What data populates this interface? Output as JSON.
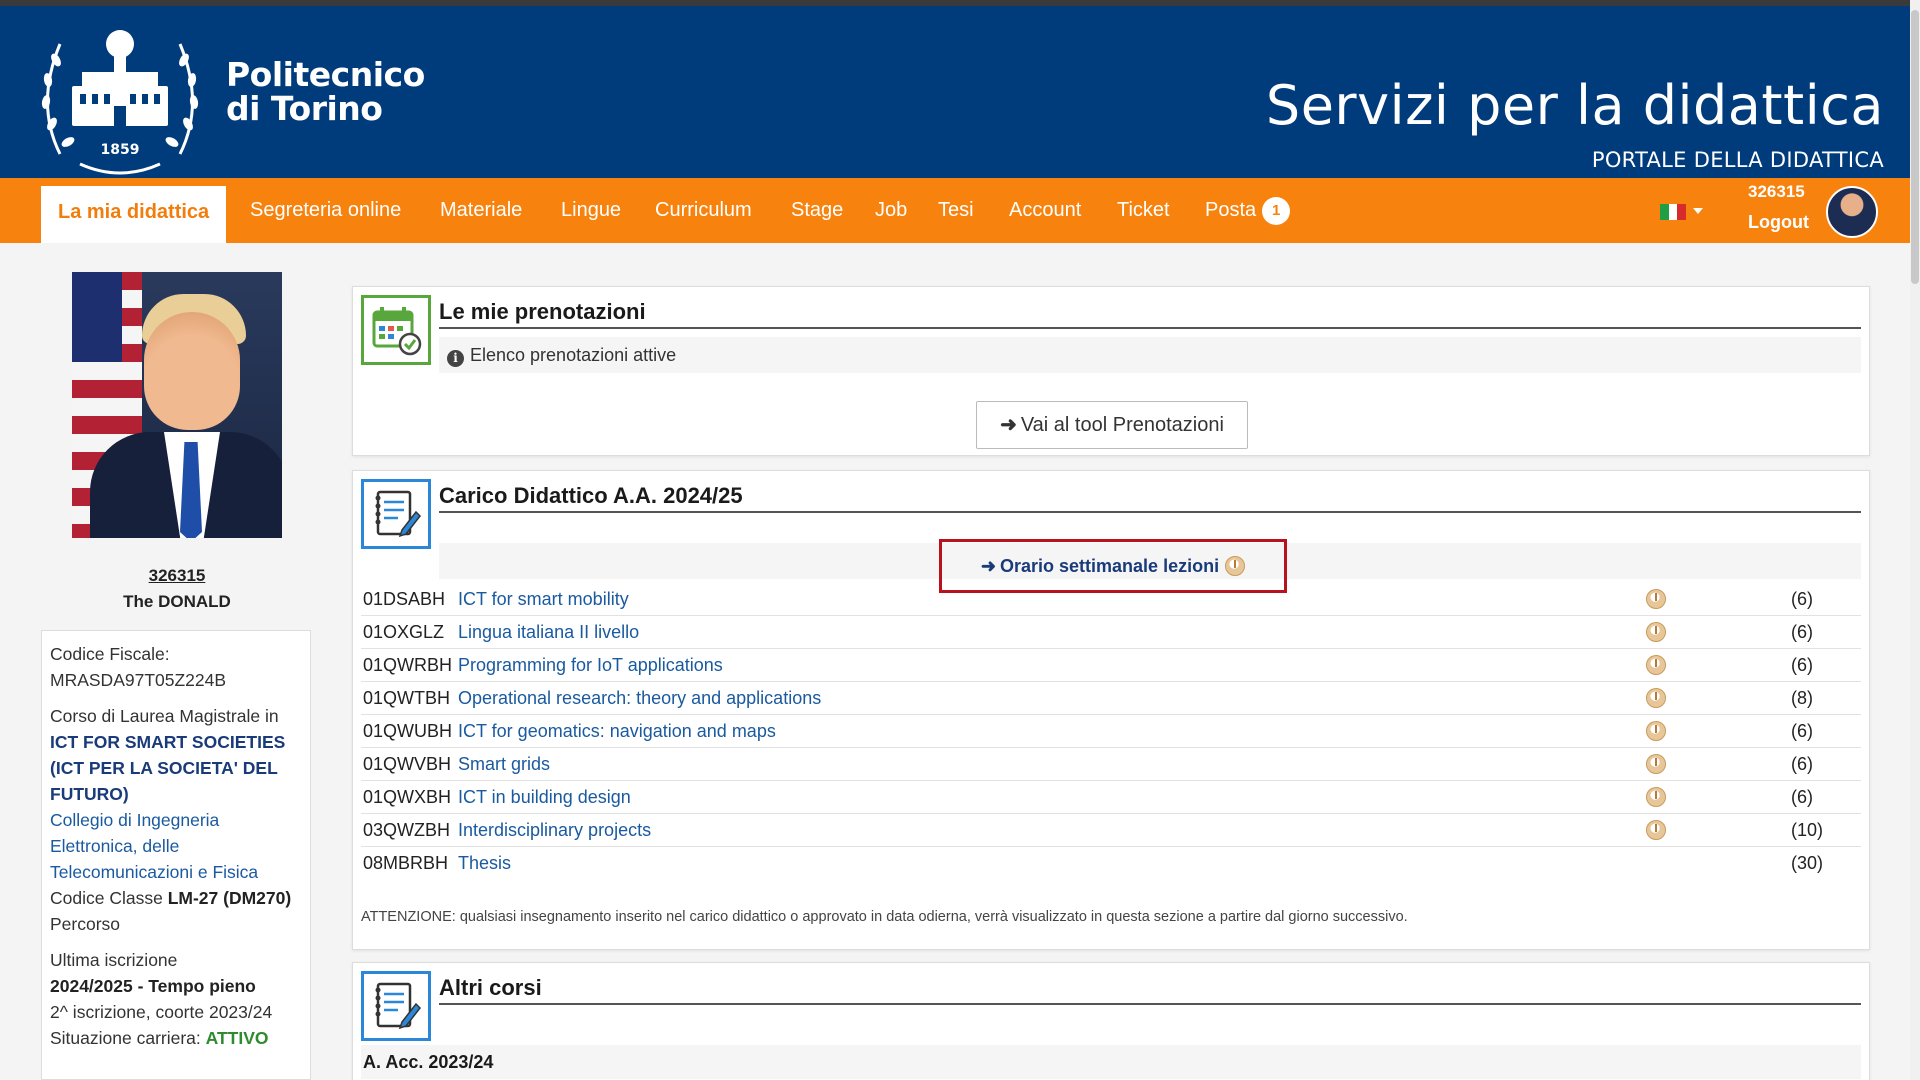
{
  "header": {
    "logo_line1": "Politecnico",
    "logo_line2": "di Torino",
    "seal_year": "1859",
    "title": "Servizi per la didattica",
    "subtitle": "PORTALE DELLA DIDATTICA",
    "colors": {
      "header_bg": "#003b7c",
      "nav_bg": "#f7830e"
    }
  },
  "nav": {
    "items": [
      {
        "label": "La mia didattica",
        "active": true
      },
      {
        "label": "Segreteria online"
      },
      {
        "label": "Materiale"
      },
      {
        "label": "Lingue"
      },
      {
        "label": "Curriculum"
      },
      {
        "label": "Stage"
      },
      {
        "label": "Job"
      },
      {
        "label": "Tesi"
      },
      {
        "label": "Account"
      },
      {
        "label": "Ticket"
      },
      {
        "label": "Posta",
        "badge": "1"
      }
    ],
    "language_flag": "italy-flag-icon",
    "user_id": "326315",
    "logout": "Logout"
  },
  "profile": {
    "matricola": "326315",
    "name": "The DONALD",
    "codice_fiscale_label": "Codice Fiscale:",
    "codice_fiscale": "MRASDA97T05Z224B",
    "corso_label": "Corso di Laurea Magistrale in",
    "corso_name": "ICT FOR SMART SOCIETIES (ICT PER LA SOCIETA' DEL FUTURO)",
    "collegio": "Collegio di Ingegneria Elettronica, delle Telecomunicazioni e Fisica",
    "classe_label": "Codice Classe",
    "classe_value": "LM-27 (DM270)",
    "percorso": "Percorso",
    "ultima_label": "Ultima iscrizione",
    "ultima_value": "2024/2025 - Tempo pieno",
    "iscrizione": "2^ iscrizione, coorte 2023/24",
    "situazione_label": "Situazione carriera:",
    "situazione_value": "ATTIVO"
  },
  "prenotazioni": {
    "title": "Le mie prenotazioni",
    "info": "Elenco prenotazioni attive",
    "button": "Vai al tool Prenotazioni"
  },
  "carico": {
    "title": "Carico Didattico A.A. 2024/25",
    "orario_link": "Orario settimanale lezioni",
    "courses": [
      {
        "code": "01DSABH",
        "name": "ICT for smart mobility",
        "clock": true,
        "cfu": "(6)"
      },
      {
        "code": "01OXGLZ",
        "name": "Lingua italiana II livello",
        "clock": true,
        "cfu": "(6)"
      },
      {
        "code": "01QWRBH",
        "name": "Programming for IoT applications",
        "clock": true,
        "cfu": "(6)"
      },
      {
        "code": "01QWTBH",
        "name": "Operational research: theory and applications",
        "clock": true,
        "cfu": "(8)"
      },
      {
        "code": "01QWUBH",
        "name": "ICT for geomatics: navigation and maps",
        "clock": true,
        "cfu": "(6)"
      },
      {
        "code": "01QWVBH",
        "name": "Smart grids",
        "clock": true,
        "cfu": "(6)"
      },
      {
        "code": "01QWXBH",
        "name": "ICT in building design",
        "clock": true,
        "cfu": "(6)"
      },
      {
        "code": "03QWZBH",
        "name": "Interdisciplinary projects",
        "clock": true,
        "cfu": "(10)"
      },
      {
        "code": "08MBRBH",
        "name": "Thesis",
        "clock": false,
        "cfu": "(30)"
      }
    ],
    "note": "ATTENZIONE: qualsiasi insegnamento inserito nel carico didattico o approvato in data odierna, verrà visualizzato in questa sezione a partire dal giorno successivo."
  },
  "altri": {
    "title": "Altri corsi",
    "year": "A. Acc. 2023/24"
  }
}
